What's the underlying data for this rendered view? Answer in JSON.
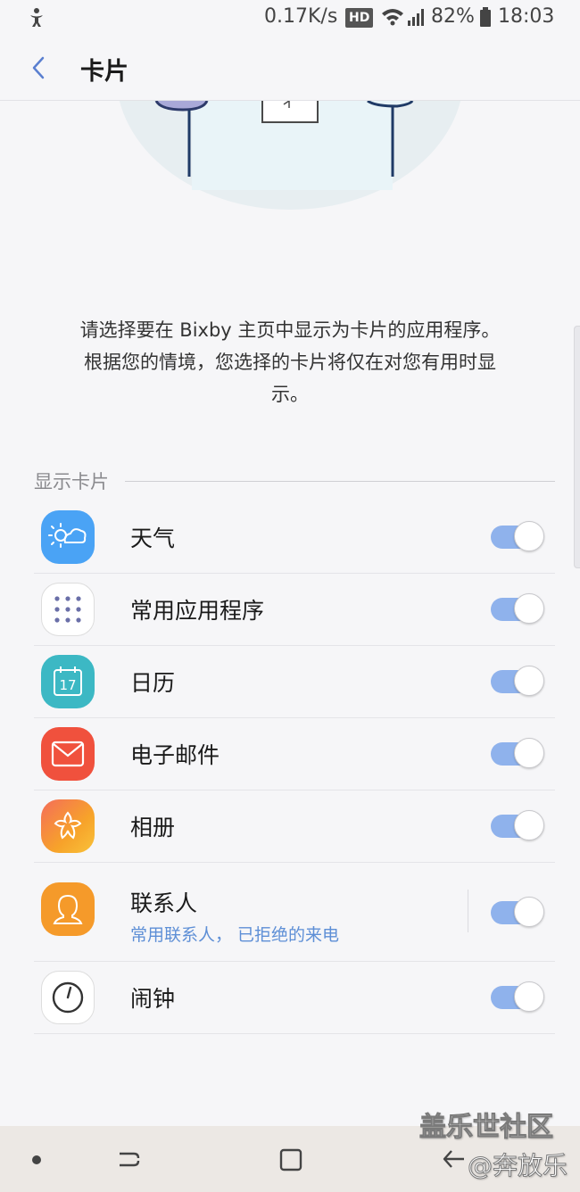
{
  "status_bar": {
    "left_icon": "accessibility-icon",
    "net_speed": "0.17K/s",
    "hd_badge": "HD",
    "battery_percent": "82%",
    "time": "18:03"
  },
  "app_bar": {
    "back_icon": "chevron-left-icon",
    "title": "卡片"
  },
  "description": "请选择要在 Bixby 主页中显示为卡片的应用程序。根据您的情境，您选择的卡片将仅在对您有用时显示。",
  "section": {
    "header": "显示卡片"
  },
  "cards": [
    {
      "title": "天气",
      "subtitle": "",
      "icon": "weather-icon",
      "enabled": true
    },
    {
      "title": "常用应用程序",
      "subtitle": "",
      "icon": "apps-grid-icon",
      "enabled": true
    },
    {
      "title": "日历",
      "subtitle": "",
      "icon": "calendar-icon",
      "icon_text": "17",
      "enabled": true
    },
    {
      "title": "电子邮件",
      "subtitle": "",
      "icon": "email-icon",
      "enabled": true
    },
    {
      "title": "相册",
      "subtitle": "",
      "icon": "gallery-icon",
      "enabled": true
    },
    {
      "title": "联系人",
      "subtitle": "常用联系人， 已拒绝的来电",
      "icon": "contacts-icon",
      "enabled": true
    },
    {
      "title": "闹钟",
      "subtitle": "",
      "icon": "clock-icon",
      "enabled": true
    }
  ],
  "colors": {
    "toggle_on": "#8fb2ec",
    "subtitle": "#5e8fd6",
    "weather": "#4aa3f5",
    "calendar": "#3cb8c4",
    "email": "#f0513d",
    "gallery": "#f7a22a",
    "contacts": "#f59a2a"
  },
  "nav_bar": {
    "icons": [
      "dot-icon",
      "recent-apps-icon",
      "home-icon",
      "back-icon"
    ]
  },
  "watermark": {
    "line1": "盖乐世社区",
    "line2": "@奔放乐"
  }
}
